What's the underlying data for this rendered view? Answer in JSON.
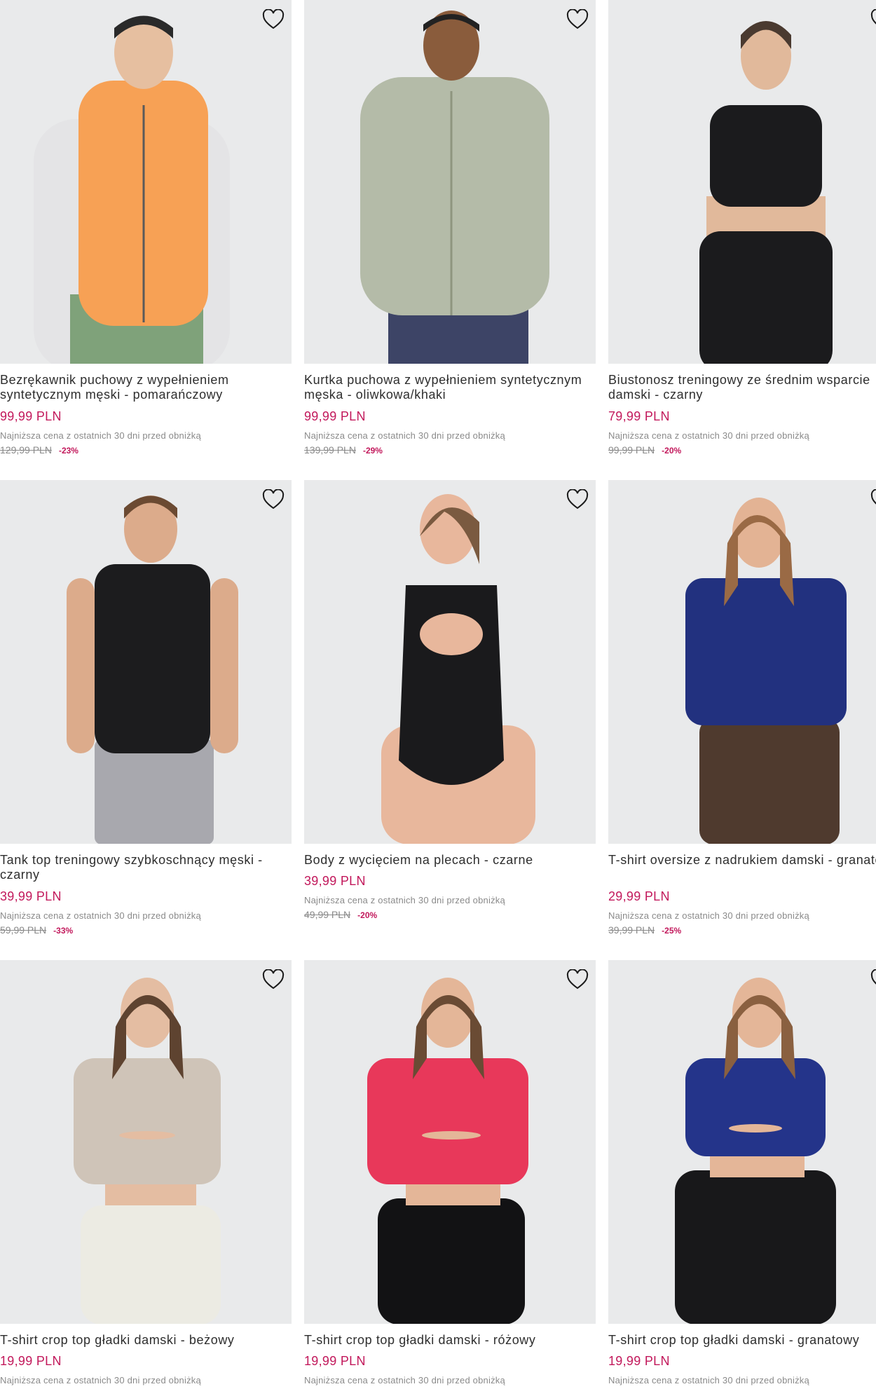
{
  "icons": {
    "wishlist": "heart-outline-icon"
  },
  "colors": {
    "price": "#c2185b",
    "image_bg": "#e9eaeb"
  },
  "products": [
    {
      "title": "Bezrękawnik puchowy z wypełnieniem syntetycznym męski - pomarańczowy",
      "price": "99,99 PLN",
      "lowest_label": "Najniższa cena z ostatnich 30 dni przed obniżką",
      "old_price": "129,99 PLN",
      "discount": "-23%"
    },
    {
      "title": "Kurtka puchowa z wypełnieniem syntetycznym męska - oliwkowa/khaki",
      "price": "99,99 PLN",
      "lowest_label": "Najniższa cena z ostatnich 30 dni przed obniżką",
      "old_price": "139,99 PLN",
      "discount": "-29%"
    },
    {
      "title": "Biustonosz treningowy ze średnim wsparcie damski - czarny",
      "price": "79,99 PLN",
      "lowest_label": "Najniższa cena z ostatnich 30 dni przed obniżką",
      "old_price": "99,99 PLN",
      "discount": "-20%"
    },
    {
      "title": "Tank top treningowy szybkoschnący męski - czarny",
      "price": "39,99 PLN",
      "lowest_label": "Najniższa cena z ostatnich 30 dni przed obniżką",
      "old_price": "59,99 PLN",
      "discount": "-33%"
    },
    {
      "title": "Body z wycięciem na plecach - czarne",
      "price": "39,99 PLN",
      "lowest_label": "Najniższa cena z ostatnich 30 dni przed obniżką",
      "old_price": "49,99 PLN",
      "discount": "-20%"
    },
    {
      "title": "T-shirt oversize z nadrukiem damski - granatowy",
      "price": "29,99 PLN",
      "lowest_label": "Najniższa cena z ostatnich 30 dni przed obniżką",
      "old_price": "39,99 PLN",
      "discount": "-25%"
    },
    {
      "title": "T-shirt crop top gładki damski - beżowy",
      "price": "19,99 PLN",
      "lowest_label": "Najniższa cena z ostatnich 30 dni przed obniżką"
    },
    {
      "title": "T-shirt crop top gładki damski - różowy",
      "price": "19,99 PLN",
      "lowest_label": "Najniższa cena z ostatnich 30 dni przed obniżką"
    },
    {
      "title": "T-shirt crop top gładki damski - granatowy",
      "price": "19,99 PLN",
      "lowest_label": "Najniższa cena z ostatnich 30 dni przed obniżką"
    }
  ]
}
